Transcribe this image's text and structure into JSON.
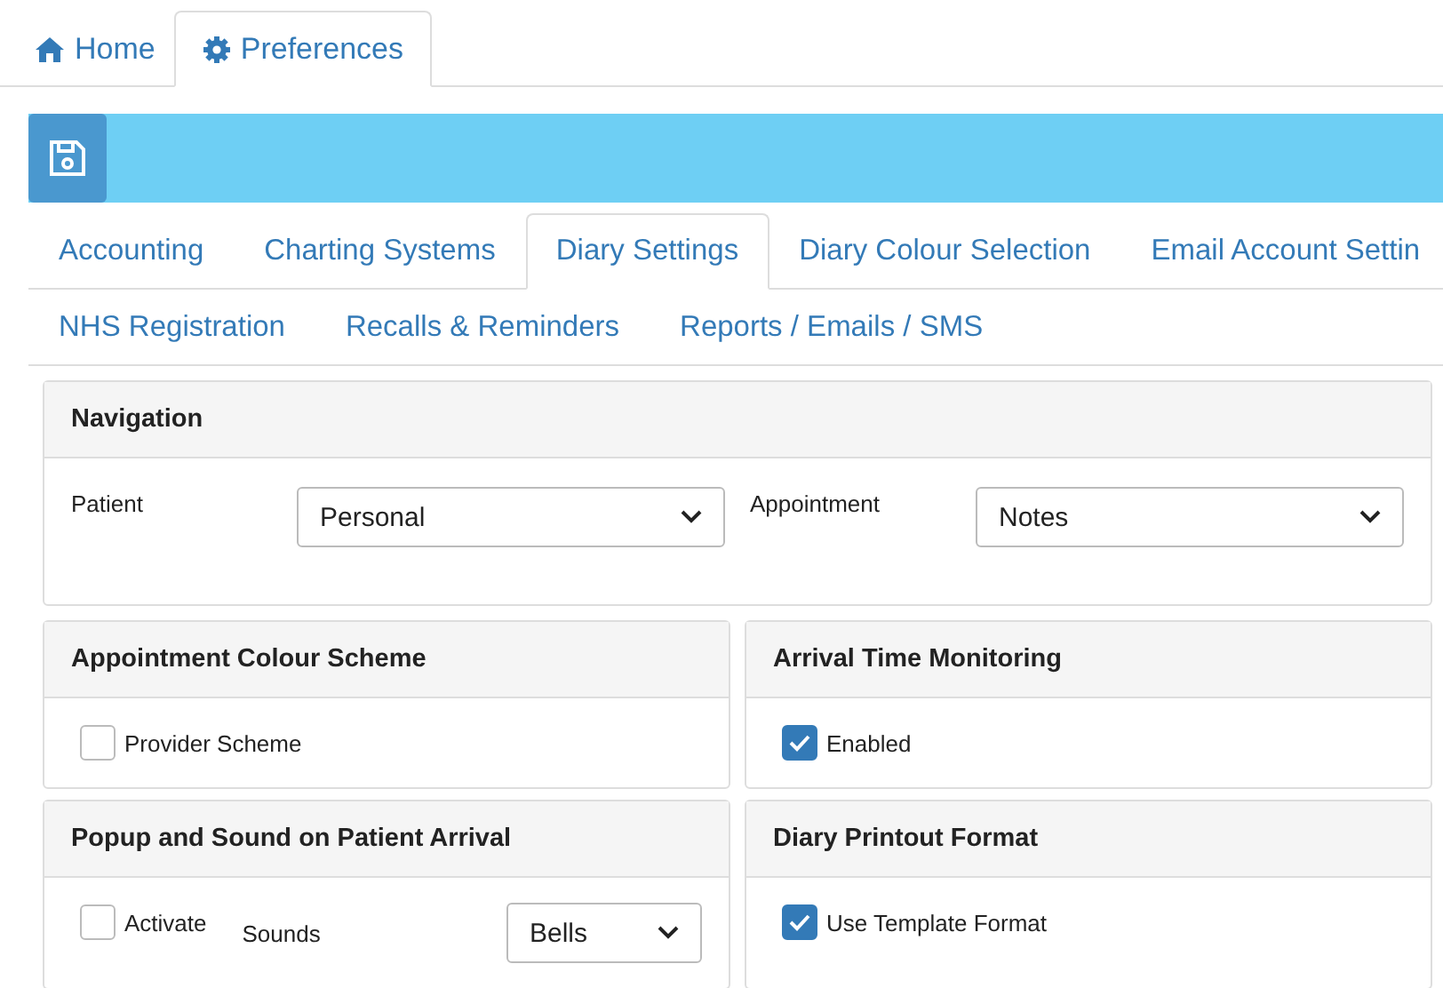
{
  "top_tabs": [
    {
      "kind": "home",
      "label": "Home",
      "selected": false
    },
    {
      "kind": "gear",
      "label": "Preferences",
      "selected": true
    }
  ],
  "sub_tabs": [
    [
      {
        "label": "Accounting",
        "selected": false
      },
      {
        "label": "Charting Systems",
        "selected": false
      },
      {
        "label": "Diary Settings",
        "selected": true
      },
      {
        "label": "Diary Colour Selection",
        "selected": false
      },
      {
        "label": "Email Account Settin",
        "selected": false
      }
    ],
    [
      {
        "label": "NHS Registration",
        "selected": false
      },
      {
        "label": "Recalls & Reminders",
        "selected": false
      },
      {
        "label": "Reports / Emails / SMS",
        "selected": false
      }
    ]
  ],
  "navigation": {
    "title": "Navigation",
    "fields": [
      {
        "label": "Patient",
        "value": "Personal"
      },
      {
        "label": "Appointment",
        "value": "Notes"
      }
    ]
  },
  "panels": [
    {
      "title": "Appointment Colour Scheme",
      "items": [
        {
          "kind": "checkbox",
          "label": "Provider Scheme",
          "checked": false
        }
      ]
    },
    {
      "title": "Arrival Time Monitoring",
      "items": [
        {
          "kind": "checkbox",
          "label": "Enabled",
          "checked": true
        }
      ]
    },
    {
      "title": "Popup and Sound on Patient Arrival",
      "items": [
        {
          "kind": "checkbox",
          "label": "Activate",
          "checked": false
        },
        {
          "kind": "select",
          "label": "Sounds",
          "value": "Bells"
        }
      ]
    },
    {
      "title": "Diary Printout Format",
      "items": [
        {
          "kind": "checkbox",
          "label": "Use Template Format",
          "checked": true
        }
      ]
    }
  ]
}
